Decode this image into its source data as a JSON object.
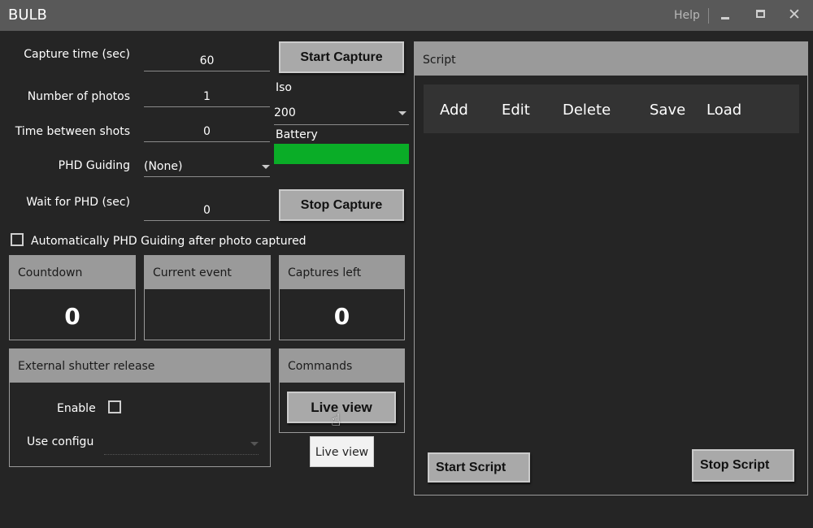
{
  "window": {
    "title": "BULB",
    "help": "Help",
    "minimize_icon": "minimize-icon",
    "maximize_icon": "maximize-icon",
    "close_glyph": "✕"
  },
  "capture": {
    "capture_time_label": "Capture time (sec)",
    "capture_time_value": "60",
    "num_photos_label": "Number of photos",
    "num_photos_value": "1",
    "time_between_label": "Time between shots",
    "time_between_value": "0",
    "phd_guiding_label": "PHD Guiding",
    "phd_guiding_value": "(None)",
    "wait_phd_label": "Wait for PHD (sec)",
    "wait_phd_value": "0",
    "auto_phd_label": "Automatically PHD Guiding after photo captured",
    "auto_phd_checked": false
  },
  "controls": {
    "start_capture": "Start Capture",
    "stop_capture": "Stop Capture",
    "iso_label": "Iso",
    "iso_value": "200",
    "battery_label": "Battery",
    "battery_level_percent": 100,
    "battery_color": "#0aad27"
  },
  "status": {
    "countdown_label": "Countdown",
    "countdown_value": "0",
    "current_event_label": "Current event",
    "current_event_value": "",
    "captures_left_label": "Captures left",
    "captures_left_value": "0"
  },
  "external_shutter": {
    "title": "External shutter release",
    "enable_label": "Enable",
    "enable_checked": false,
    "use_config_label": "Use configu"
  },
  "commands": {
    "title": "Commands",
    "live_view": "Live view",
    "tooltip": "Live view"
  },
  "script": {
    "title": "Script",
    "toolbar": [
      "Add",
      "Edit",
      "Delete",
      "Save",
      "Load"
    ],
    "start_script": "Start Script",
    "stop_script": "Stop Script"
  },
  "colors": {
    "background": "#252525",
    "titlebar": "#595959",
    "panel_header": "#9a9a9a",
    "button": "#a9a9a9",
    "battery": "#0aad27"
  }
}
